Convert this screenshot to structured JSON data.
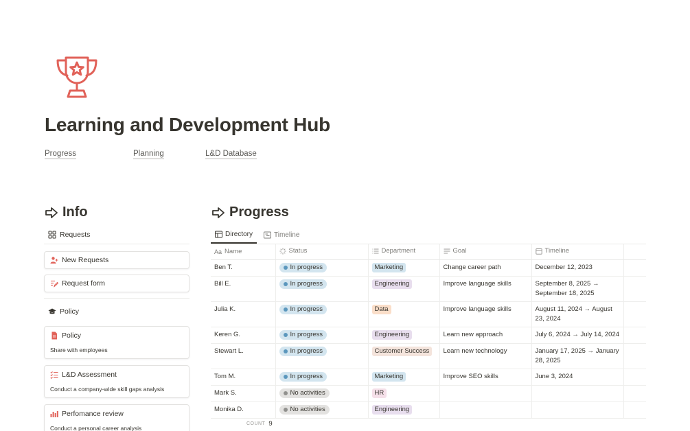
{
  "page": {
    "title": "Learning and Development Hub",
    "icon": "trophy-icon"
  },
  "links": [
    {
      "label": "Progress"
    },
    {
      "label": "Planning"
    },
    {
      "label": "L&D Database"
    }
  ],
  "info": {
    "heading": "Info",
    "requests_section": "Requests",
    "new_requests": "New Requests",
    "request_form": "Request form",
    "policy_section": "Policy",
    "policy_card": {
      "title": "Policy",
      "desc": "Share with employees"
    },
    "ld_assessment": {
      "title": "L&D Assessment",
      "desc": "Conduct a company-wide skill gaps analysis"
    },
    "performance_review": {
      "title": "Perfomance review",
      "desc": "Conduct a personal career analysis"
    }
  },
  "progress": {
    "heading": "Progress",
    "views": [
      "Directory",
      "Timeline"
    ],
    "columns": [
      "Name",
      "Status",
      "Department",
      "Goal",
      "Timeline"
    ],
    "name_col_prefix": "Aa",
    "rows": [
      {
        "name": "Ben T.",
        "status": "In progress",
        "department": "Marketing",
        "goal": "Change career path",
        "timeline": "December 12, 2023"
      },
      {
        "name": "Bill E.",
        "status": "In progress",
        "department": "Engineering",
        "goal": "Improve language skills",
        "timeline": "September 8, 2025 → September 18, 2025"
      },
      {
        "name": "Julia K.",
        "status": "In progress",
        "department": "Data",
        "goal": "Improve language skills",
        "timeline": "August 11, 2024 → August 23, 2024"
      },
      {
        "name": "Keren G.",
        "status": "In progress",
        "department": "Engineering",
        "goal": "Learn new approach",
        "timeline": "July 6, 2024 → July 14, 2024"
      },
      {
        "name": "Stewart L.",
        "status": "In progress",
        "department": "Customer Success",
        "goal": "Learn new technology",
        "timeline": "January 17, 2025 → January 28, 2025"
      },
      {
        "name": "Tom M.",
        "status": "In progress",
        "department": "Marketing",
        "goal": "Improve SEO skills",
        "timeline": "June 3, 2024"
      },
      {
        "name": "Mark S.",
        "status": "No activities",
        "department": "HR",
        "goal": "",
        "timeline": ""
      },
      {
        "name": "Monika D.",
        "status": "No activities",
        "department": "Engineering",
        "goal": "",
        "timeline": ""
      }
    ],
    "count_label": "COUNT",
    "count_value": "9"
  },
  "colors": {
    "accent": "#e16259",
    "in_progress_bg": "#d3e5ef",
    "in_progress_dot": "#5b97bd",
    "no_activities_bg": "#e3e2e0",
    "no_activities_dot": "#91918e",
    "dept": {
      "Marketing": "#d3e5ef",
      "Engineering": "#e8deee",
      "Data": "#fadec9",
      "Customer Success": "#f4e4dc",
      "HR": "#f5e0e9"
    }
  }
}
